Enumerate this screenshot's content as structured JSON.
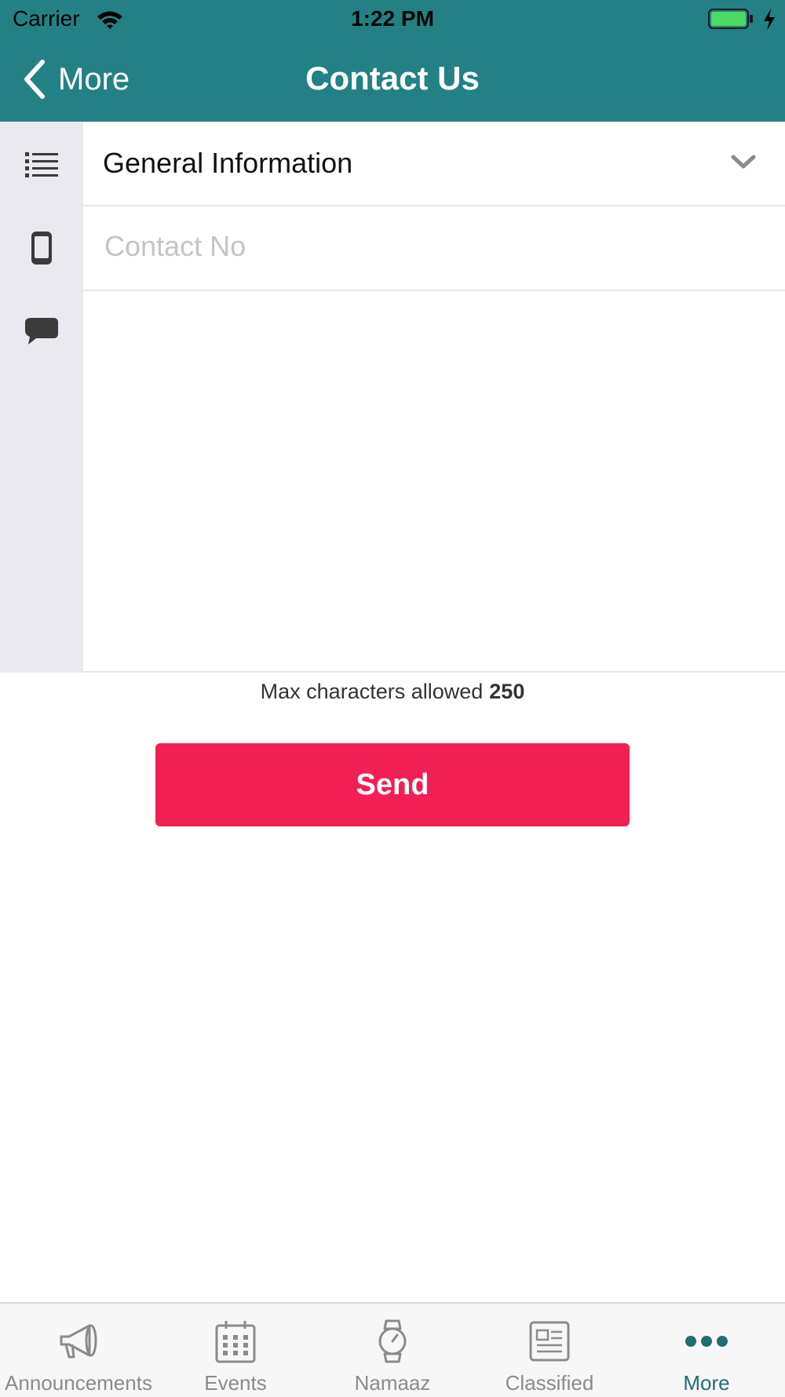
{
  "status_bar": {
    "carrier": "Carrier",
    "time": "1:22 PM"
  },
  "nav": {
    "back_label": "More",
    "title": "Contact Us"
  },
  "form": {
    "category_value": "General Information",
    "contact_placeholder": "Contact No",
    "message_value": "",
    "max_chars_label": "Max characters allowed",
    "max_chars_value": "250",
    "send_label": "Send"
  },
  "tabs": [
    {
      "label": "Announcements",
      "icon": "megaphone-icon"
    },
    {
      "label": "Events",
      "icon": "calendar-icon"
    },
    {
      "label": "Namaaz",
      "icon": "watch-icon"
    },
    {
      "label": "Classified",
      "icon": "newspaper-icon"
    },
    {
      "label": "More",
      "icon": "more-dots-icon",
      "active": true
    }
  ],
  "colors": {
    "header": "#238185",
    "send_button": "#f21f55",
    "sidebar": "#e9e9ef",
    "active_tab": "#1f6f72",
    "inactive_tab": "#8b8b8b"
  }
}
